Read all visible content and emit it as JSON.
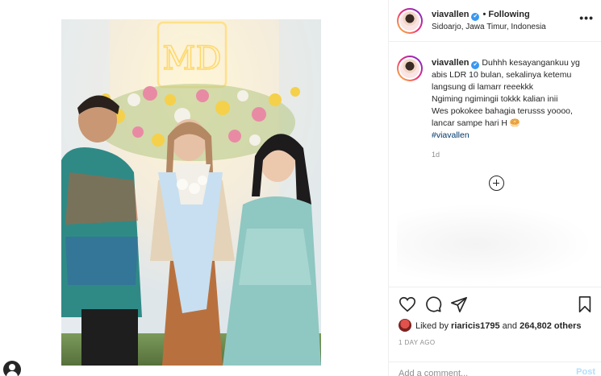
{
  "post": {
    "author": "viavallen",
    "verified_mark": "✔",
    "dot": "•",
    "follow_status": "Following",
    "location": "Sidoarjo, Jawa Timur, Indonesia",
    "more_label": "•••"
  },
  "caption": {
    "author": "viavallen",
    "text": "Duhhh kesayangankuu yg abis LDR 10 bulan, sekalinya ketemu langsung di lamarr reeekkk\nNgiming ngimingii tokkk kalian inii\nWes pokokee bahagia terusss yoooo, lancar sampe hari H 🥯",
    "hashtag": "#viavallen",
    "age": "1d"
  },
  "photo": {
    "neon_sign": "MD",
    "backdrop_color": "#dfe6ea",
    "floral_colors": [
      "#f5d04a",
      "#e98aa5",
      "#f4f1e8",
      "#9bbf6a"
    ]
  },
  "likes": {
    "prefix": "Liked by",
    "liker": "riaricis1795",
    "joiner": "and",
    "others": "264,802 others"
  },
  "timestamp": "1 DAY AGO",
  "comment_box": {
    "placeholder": "Add a comment...",
    "post_label": "Post"
  },
  "icons": [
    "heart-icon",
    "comment-icon",
    "share-icon",
    "bookmark-icon",
    "add-icon",
    "more-icon"
  ],
  "colors": {
    "link": "#00376b",
    "verified": "#3897f0",
    "muted": "#8e8e8e",
    "post_disabled": "#b2dffc"
  }
}
